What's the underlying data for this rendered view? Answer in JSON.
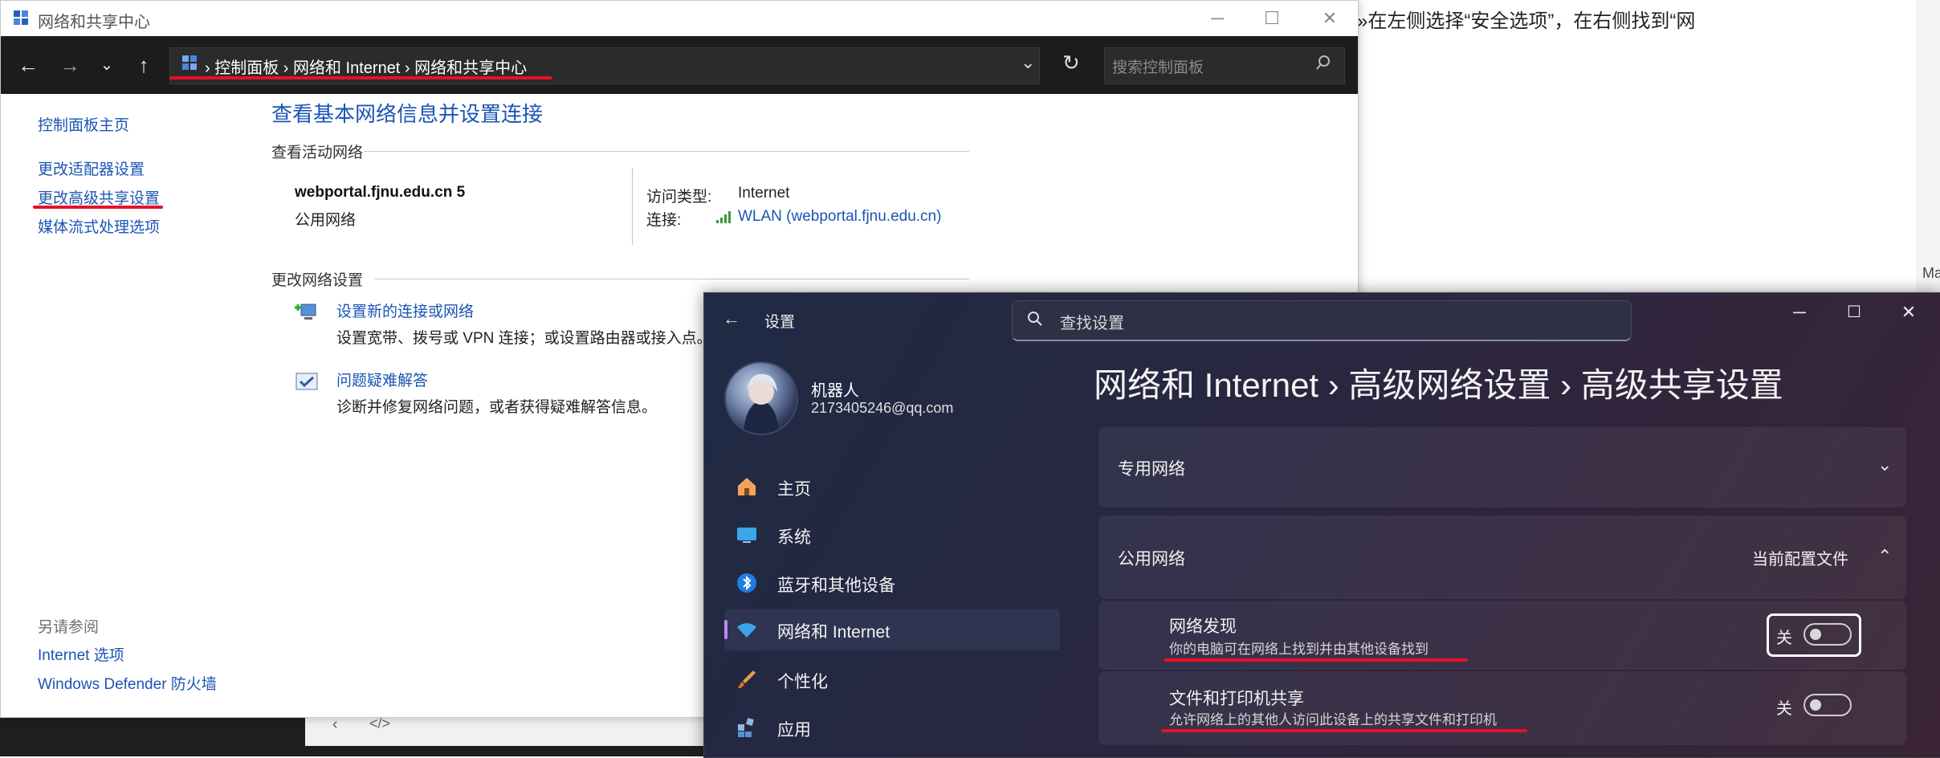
{
  "background": {
    "doc_text": "»在左侧选择“安全选项”，在右侧找到“网",
    "side_text": "Ma"
  },
  "control_panel": {
    "window_title": "网络和共享中心",
    "controls": {
      "minimize": "─",
      "maximize": "☐",
      "close": "✕"
    },
    "address": {
      "crumbs": "›  控制面板  ›  网络和 Internet  ›  网络和共享中心"
    },
    "search_placeholder": "搜索控制面板",
    "left_nav": {
      "home": "控制面板主页",
      "adapter": "更改适配器设置",
      "advanced_sharing": "更改高级共享设置",
      "media_streaming": "媒体流式处理选项",
      "see_also": "另请参阅",
      "internet_options": "Internet 选项",
      "firewall": "Windows Defender 防火墙"
    },
    "main": {
      "heading": "查看基本网络信息并设置连接",
      "active_networks_label": "查看活动网络",
      "network_name": "webportal.fjnu.edu.cn 5",
      "network_type": "公用网络",
      "access_type_label": "访问类型:",
      "access_type_value": "Internet",
      "connection_label": "连接:",
      "connection_value": "WLAN (webportal.fjnu.edu.cn)",
      "change_settings_label": "更改网络设置",
      "task1_link": "设置新的连接或网络",
      "task1_desc": "设置宽带、拨号或 VPN 连接；或设置路由器或接入点。",
      "task2_link": "问题疑难解答",
      "task2_desc": "诊断并修复网络问题，或者获得疑难解答信息。"
    }
  },
  "settings": {
    "title": "设置",
    "search_placeholder": "查找设置",
    "user": {
      "name": "机器人",
      "email": "2173405246@qq.com"
    },
    "nav": [
      {
        "label": "主页",
        "icon": "home-icon"
      },
      {
        "label": "系统",
        "icon": "system-icon"
      },
      {
        "label": "蓝牙和其他设备",
        "icon": "bluetooth-icon"
      },
      {
        "label": "网络和 Internet",
        "icon": "wifi-icon",
        "active": true
      },
      {
        "label": "个性化",
        "icon": "brush-icon"
      },
      {
        "label": "应用",
        "icon": "apps-icon"
      }
    ],
    "breadcrumb": "网络和 Internet  ›  高级网络设置  ›  高级共享设置",
    "private_network": "专用网络",
    "public_network": "公用网络",
    "current_profile": "当前配置文件",
    "network_discovery": {
      "title": "网络发现",
      "sub": "你的电脑可在网络上找到并由其他设备找到",
      "state": "关"
    },
    "file_sharing": {
      "title": "文件和打印机共享",
      "sub": "允许网络上的其他人访问此设备上的共享文件和打印机",
      "state": "关"
    }
  }
}
